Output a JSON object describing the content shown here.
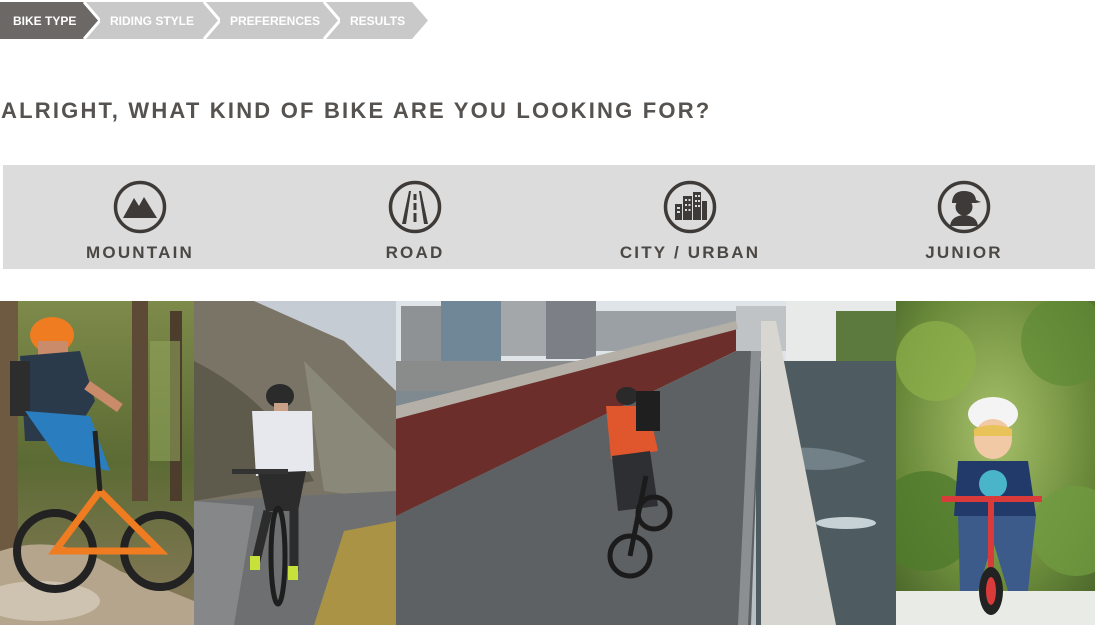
{
  "steps": [
    {
      "label": "BIKE TYPE",
      "state": "active",
      "color": "#6b6866"
    },
    {
      "label": "RIDING STYLE",
      "state": "inactive",
      "color": "#c9c9c9"
    },
    {
      "label": "PREFERENCES",
      "state": "inactive",
      "color": "#c9c9c9"
    },
    {
      "label": "RESULTS",
      "state": "inactive",
      "color": "#c9c9c9"
    }
  ],
  "heading": "ALRIGHT, WHAT KIND OF BIKE ARE YOU LOOKING FOR?",
  "bike_types": [
    {
      "label": "MOUNTAIN",
      "icon": "mountain-icon"
    },
    {
      "label": "ROAD",
      "icon": "road-icon"
    },
    {
      "label": "CITY / URBAN",
      "icon": "city-icon"
    },
    {
      "label": "JUNIOR",
      "icon": "junior-icon"
    }
  ],
  "photos": [
    {
      "subject": "mountain-bike-photo"
    },
    {
      "subject": "road-bike-photo"
    },
    {
      "subject": "city-bike-photo"
    },
    {
      "subject": "junior-bike-photo"
    }
  ],
  "colors": {
    "step_active": "#6b6866",
    "step_inactive": "#c9c9c9",
    "heading": "#55524f",
    "type_bar": "#dcdcdc",
    "icon": "#3d3a38"
  }
}
